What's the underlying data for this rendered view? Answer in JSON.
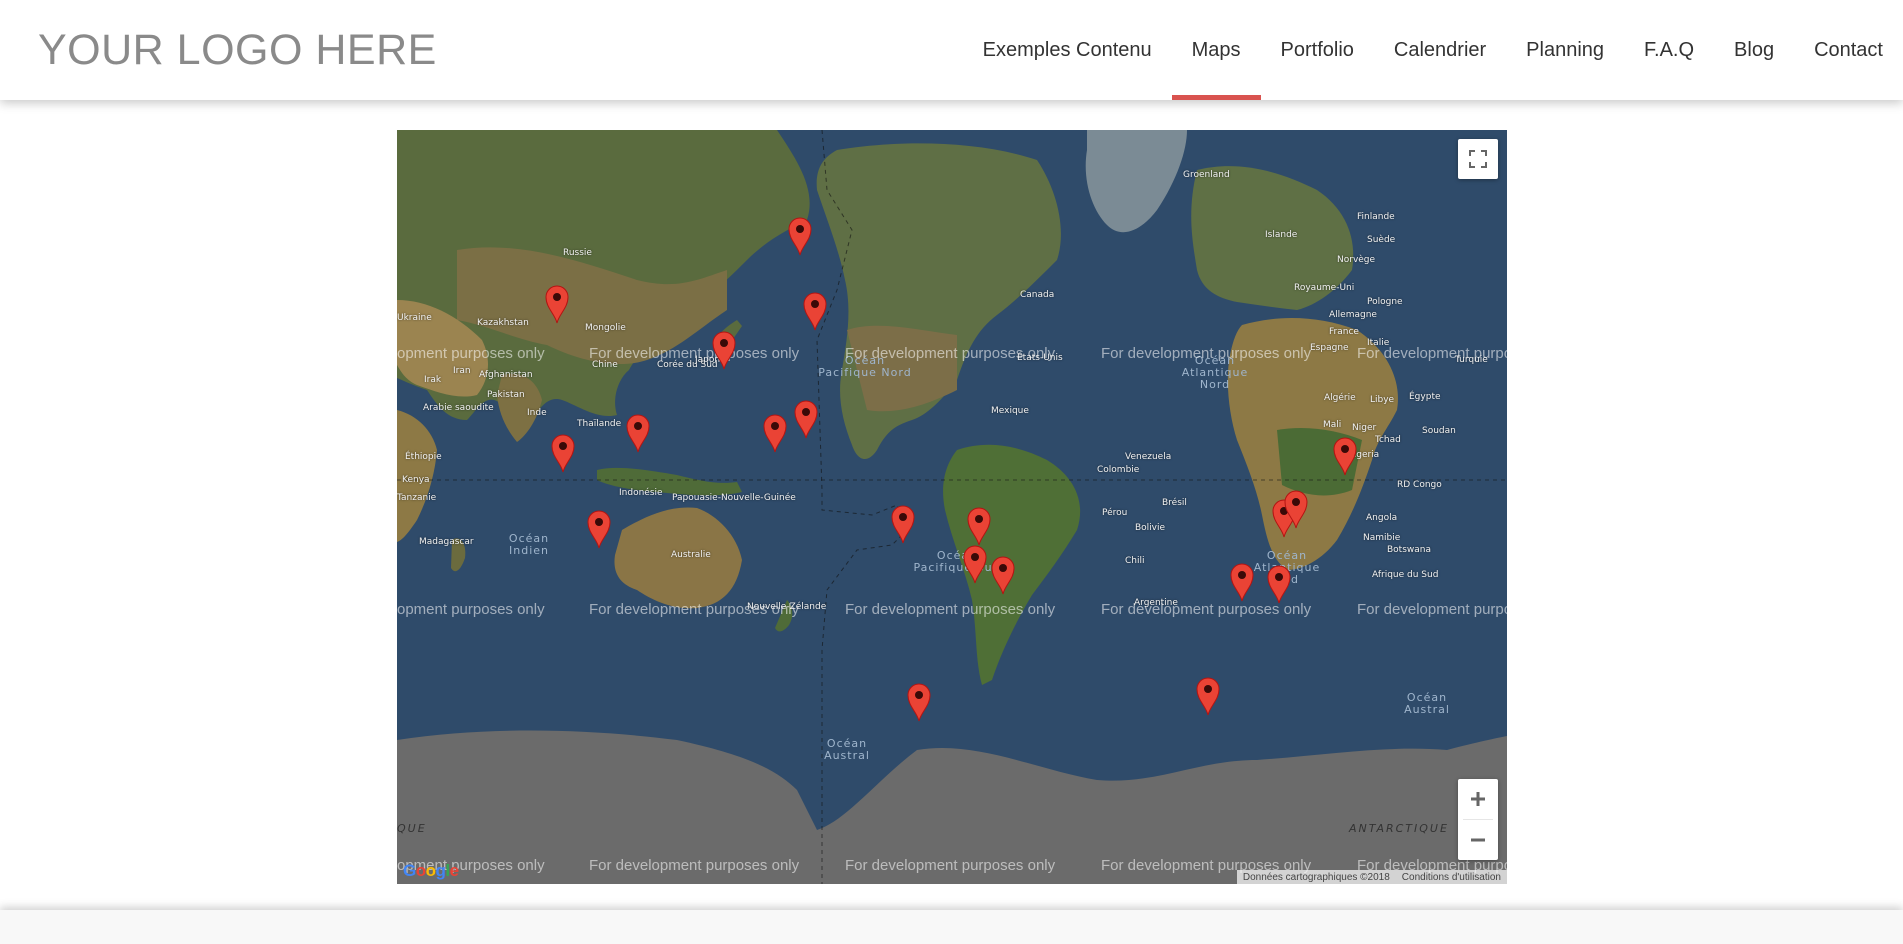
{
  "header": {
    "logo": "YOUR LOGO HERE",
    "nav": [
      {
        "label": "Exemples Contenu",
        "active": false
      },
      {
        "label": "Maps",
        "active": true
      },
      {
        "label": "Portfolio",
        "active": false
      },
      {
        "label": "Calendrier",
        "active": false
      },
      {
        "label": "Planning",
        "active": false
      },
      {
        "label": "F.A.Q",
        "active": false
      },
      {
        "label": "Blog",
        "active": false
      },
      {
        "label": "Contact",
        "active": false
      }
    ],
    "accent_color": "#d9534f"
  },
  "map": {
    "watermark": "For development purposes only",
    "watermark_partial_left": "opment purposes only",
    "watermark_partial_right": "For development purpo",
    "country_labels": [
      "Groenland",
      "Finlande",
      "Islande",
      "Suède",
      "Norvège",
      "Russie",
      "Canada",
      "Royaume-Uni",
      "Pologne",
      "Allemagne",
      "France",
      "Espagne",
      "Italie",
      "Turquie",
      "Kazakhstan",
      "Mongolie",
      "Chine",
      "Corée du Sud",
      "Japon",
      "Afghanistan",
      "Irak",
      "Iran",
      "Pakistan",
      "Arabie saoudite",
      "Inde",
      "Thaïlande",
      "Indonésie",
      "Papouasie-Nouvelle-Guinée",
      "Australie",
      "Nouvelle-Zélande",
      "Éthiopie",
      "Kenya",
      "Tanzanie",
      "Madagascar",
      "Soudan",
      "Algérie",
      "Libye",
      "Égypte",
      "Mali",
      "Niger",
      "Tchad",
      "Nigeria",
      "RD Congo",
      "Angola",
      "Namibie",
      "Botswana",
      "Afrique du Sud",
      "États-Unis",
      "Mexique",
      "Venezuela",
      "Colombie",
      "Pérou",
      "Brésil",
      "Bolivie",
      "Chili",
      "Argentine",
      "Ukraine"
    ],
    "ocean_labels": [
      "Océan Pacifique Nord",
      "Océan Atlantique Nord",
      "Océan Indien",
      "Océan Pacifique Sud",
      "Océan Atlantique Sud",
      "Océan Austral",
      "Océan Austral"
    ],
    "antarctica_labels": [
      "QUE",
      "ANTARCTIQUE"
    ],
    "attribution": "Données cartographiques ©2018",
    "terms": "Conditions d'utilisation",
    "google_logo": "Google",
    "zoom_in_icon": "plus-icon",
    "zoom_out_icon": "minus-icon",
    "fullscreen_icon": "fullscreen-icon",
    "marker_icon": "map-pin-icon",
    "marker_color": "#ea4335",
    "marker_count": 25
  }
}
